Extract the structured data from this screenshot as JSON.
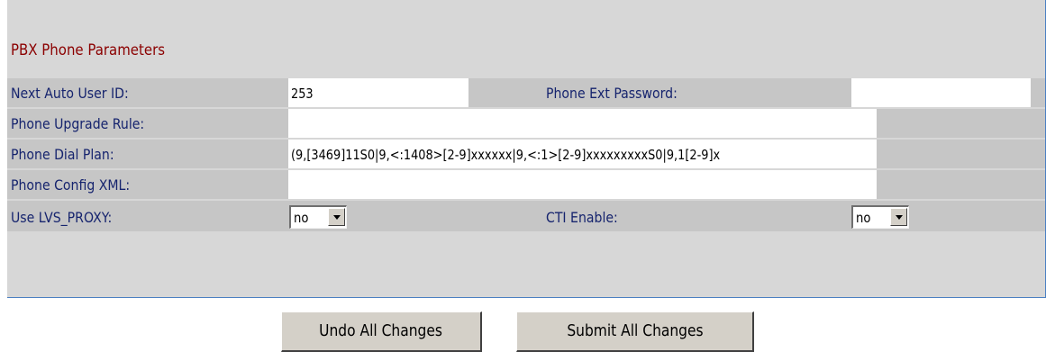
{
  "section": {
    "title": "PBX Phone Parameters"
  },
  "rows": {
    "next_auto_user_id": {
      "label": "Next Auto User ID:",
      "value": "253"
    },
    "phone_ext_password": {
      "label": "Phone Ext Password:",
      "value": ""
    },
    "phone_upgrade_rule": {
      "label": "Phone Upgrade Rule:",
      "value": ""
    },
    "phone_dial_plan": {
      "label": "Phone Dial Plan:",
      "value": "(9,[3469]11S0|9,<:1408>[2-9]xxxxxx|9,<:1>[2-9]xxxxxxxxxS0|9,1[2-9]x"
    },
    "phone_config_xml": {
      "label": "Phone Config XML:",
      "value": ""
    },
    "use_lvs_proxy": {
      "label": "Use LVS_PROXY:",
      "value": "no"
    },
    "cti_enable": {
      "label": "CTI Enable:",
      "value": "no"
    }
  },
  "buttons": {
    "undo": "Undo All Changes",
    "submit": "Submit All Changes"
  },
  "colors": {
    "panel_bg": "#d7d7d7",
    "row_bg": "#c6c6c6",
    "label_text": "#16246e",
    "section_title": "#8b0000",
    "border_blue": "#4a7fc2"
  }
}
